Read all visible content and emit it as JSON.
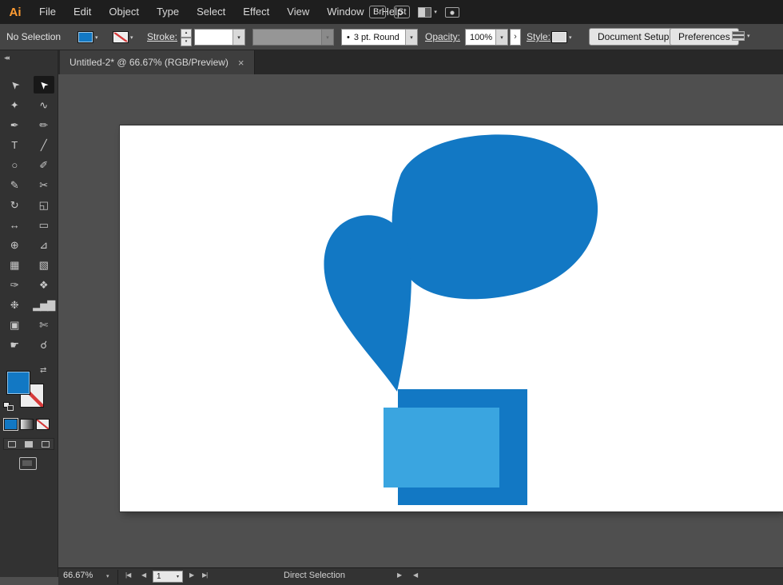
{
  "colors": {
    "artwork_primary": "#1278c4",
    "artwork_light": "#3aa5e0",
    "logo_orange": "#ff9c32",
    "none_indicator_red": "#d63a3a",
    "ui_dark": "#1e1e1e",
    "ui_panel": "#323232",
    "ui_canvas": "#4f4f4f"
  },
  "menubar": {
    "logo": "Ai",
    "items": [
      "File",
      "Edit",
      "Object",
      "Type",
      "Select",
      "Effect",
      "View",
      "Window",
      "Help"
    ],
    "bridge_badge": "Br",
    "stock_badge": "St"
  },
  "controlbar": {
    "selection_status": "No Selection",
    "stroke_label": "Stroke:",
    "brush_name": "3 pt. Round",
    "opacity_label": "Opacity:",
    "opacity_value": "100%",
    "style_label": "Style:",
    "document_setup_label": "Document Setup",
    "preferences_label": "Preferences"
  },
  "tab": {
    "title": "Untitled-2* @ 66.67% (RGB/Preview)"
  },
  "icons": {
    "caret_down": "▾",
    "caret_up": "▴",
    "chevron_right": "›",
    "close": "×",
    "collapse_panel": "◂◂",
    "swap_swatches": "⇄",
    "brush_dot": "•",
    "nav_first": "|◀",
    "nav_prev": "◀",
    "nav_next": "▶",
    "nav_last": "▶|",
    "play": "▶",
    "back": "◀"
  },
  "toolbar": {
    "tools": [
      {
        "name": "selection",
        "glyph": "➤"
      },
      {
        "name": "direct-selection",
        "glyph": "➤"
      },
      {
        "name": "magic-wand",
        "glyph": "✦"
      },
      {
        "name": "lasso",
        "glyph": "∿"
      },
      {
        "name": "pen",
        "glyph": "✒"
      },
      {
        "name": "curvature",
        "glyph": "✏"
      },
      {
        "name": "type",
        "glyph": "T"
      },
      {
        "name": "line-segment",
        "glyph": "╱"
      },
      {
        "name": "ellipse",
        "glyph": "○"
      },
      {
        "name": "paintbrush",
        "glyph": "✐"
      },
      {
        "name": "pencil",
        "glyph": "✎"
      },
      {
        "name": "scissors",
        "glyph": "✂"
      },
      {
        "name": "rotate",
        "glyph": "↻"
      },
      {
        "name": "scale",
        "glyph": "◱"
      },
      {
        "name": "width-tool",
        "glyph": "↔"
      },
      {
        "name": "free-transform",
        "glyph": "▭"
      },
      {
        "name": "shape-builder",
        "glyph": "⊕"
      },
      {
        "name": "perspective-grid",
        "glyph": "⊿"
      },
      {
        "name": "mesh",
        "glyph": "▦"
      },
      {
        "name": "gradient",
        "glyph": "▧"
      },
      {
        "name": "eyedropper",
        "glyph": "✑"
      },
      {
        "name": "blend",
        "glyph": "❖"
      },
      {
        "name": "symbol-sprayer",
        "glyph": "❉"
      },
      {
        "name": "column-graph",
        "glyph": "▂▅▇"
      },
      {
        "name": "artboard",
        "glyph": "▣"
      },
      {
        "name": "slice",
        "glyph": "✄"
      },
      {
        "name": "hand",
        "glyph": "☛"
      },
      {
        "name": "zoom",
        "glyph": "☌"
      }
    ]
  },
  "statusbar": {
    "zoom": "66.67%",
    "artboard_number": "1",
    "active_tool": "Direct Selection"
  },
  "artwork": {
    "primary_fill": "#1278c4",
    "light_fill": "#3aa5e0"
  }
}
